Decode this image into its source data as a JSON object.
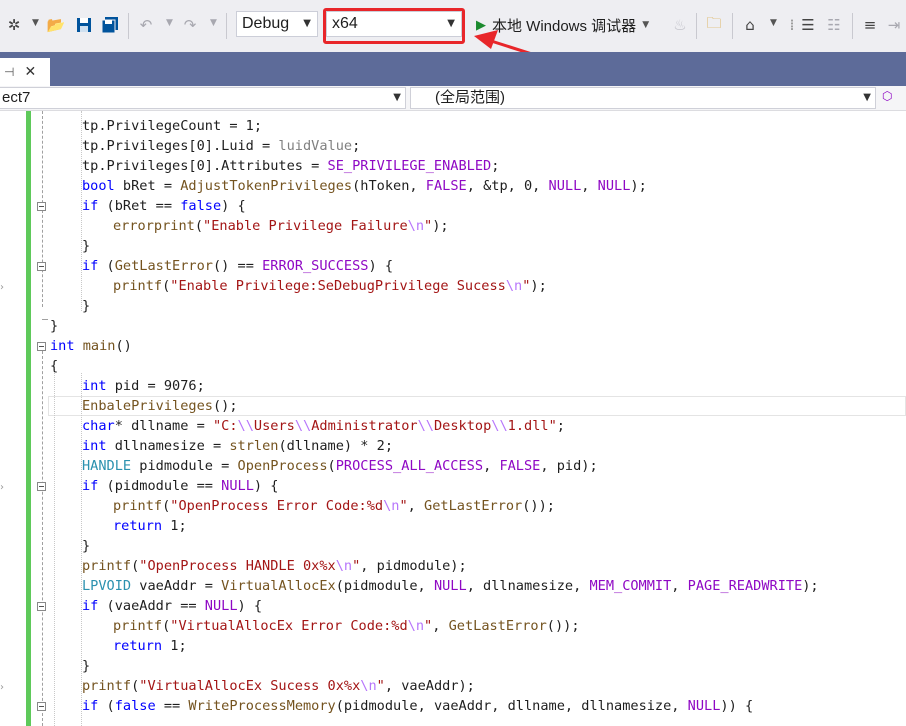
{
  "toolbar": {
    "config": "Debug",
    "platform": "x64",
    "run_label": "本地 Windows 调试器"
  },
  "tab": {
    "pin_glyph": "⊣",
    "close_glyph": "✕"
  },
  "navbar": {
    "project": "ect7",
    "scope": "(全局范围)"
  },
  "colors": {
    "keyword": "#0000ff",
    "type": "#2b91af",
    "function": "#74531f",
    "macro": "#8f08c4",
    "string": "#a31515",
    "escape": "#b776fb",
    "change_bar": "#5ec95a",
    "highlight": "#e8262a"
  },
  "code": {
    "lines": [
      {
        "indent": 1,
        "tokens": [
          [
            "tp.PrivilegeCount = 1;",
            ""
          ]
        ]
      },
      {
        "indent": 1,
        "tokens": [
          [
            "tp.Privileges[0].Luid = ",
            ""
          ],
          [
            "luidValue",
            "par"
          ],
          [
            ";",
            ""
          ]
        ]
      },
      {
        "indent": 1,
        "tokens": [
          [
            "tp.Privileges[0].Attributes = ",
            ""
          ],
          [
            "SE_PRIVILEGE_ENABLED",
            "mac"
          ],
          [
            ";",
            ""
          ]
        ]
      },
      {
        "indent": 1,
        "tokens": [
          [
            "bool",
            "kw"
          ],
          [
            " bRet = ",
            ""
          ],
          [
            "AdjustTokenPrivileges",
            "fn"
          ],
          [
            "(hToken, ",
            ""
          ],
          [
            "FALSE",
            "mac"
          ],
          [
            ", &tp, 0, ",
            ""
          ],
          [
            "NULL",
            "mac"
          ],
          [
            ", ",
            ""
          ],
          [
            "NULL",
            "mac"
          ],
          [
            ");",
            ""
          ]
        ]
      },
      {
        "indent": 1,
        "tokens": [
          [
            "if",
            "kw"
          ],
          [
            " (bRet == ",
            ""
          ],
          [
            "false",
            "kw"
          ],
          [
            ") {",
            ""
          ]
        ]
      },
      {
        "indent": 2,
        "tokens": [
          [
            "errorprint",
            "fn"
          ],
          [
            "(",
            ""
          ],
          [
            "\"Enable Privilege Failure",
            "str"
          ],
          [
            "\\n",
            "esc"
          ],
          [
            "\"",
            "str"
          ],
          [
            ");",
            ""
          ]
        ]
      },
      {
        "indent": 1,
        "tokens": [
          [
            "}",
            ""
          ]
        ]
      },
      {
        "indent": 1,
        "tokens": [
          [
            "if",
            "kw"
          ],
          [
            " (",
            ""
          ],
          [
            "GetLastError",
            "fn"
          ],
          [
            "() == ",
            ""
          ],
          [
            "ERROR_SUCCESS",
            "mac"
          ],
          [
            ") {",
            ""
          ]
        ]
      },
      {
        "indent": 2,
        "tokens": [
          [
            "printf",
            "fn"
          ],
          [
            "(",
            ""
          ],
          [
            "\"Enable Privilege:SeDebugPrivilege Sucess",
            "str"
          ],
          [
            "\\n",
            "esc"
          ],
          [
            "\"",
            "str"
          ],
          [
            ");",
            ""
          ]
        ]
      },
      {
        "indent": 1,
        "tokens": [
          [
            "}",
            ""
          ]
        ]
      },
      {
        "indent": 0,
        "tokens": [
          [
            "}",
            ""
          ]
        ]
      },
      {
        "indent": 0,
        "tokens": [
          [
            "int",
            "kw"
          ],
          [
            " ",
            ""
          ],
          [
            "main",
            "fn"
          ],
          [
            "()",
            ""
          ]
        ]
      },
      {
        "indent": 0,
        "tokens": [
          [
            "{",
            ""
          ]
        ]
      },
      {
        "indent": 1,
        "tokens": [
          [
            "int",
            "kw"
          ],
          [
            " pid = 9076;",
            ""
          ]
        ]
      },
      {
        "indent": 1,
        "tokens": [
          [
            "EnbalePrivileges",
            "fn"
          ],
          [
            "();",
            ""
          ]
        ]
      },
      {
        "indent": 1,
        "tokens": [
          [
            "char",
            "kw"
          ],
          [
            "* dllname = ",
            ""
          ],
          [
            "\"C:",
            "str"
          ],
          [
            "\\\\",
            "esc"
          ],
          [
            "Users",
            "str"
          ],
          [
            "\\\\",
            "esc"
          ],
          [
            "Administrator",
            "str"
          ],
          [
            "\\\\",
            "esc"
          ],
          [
            "Desktop",
            "str"
          ],
          [
            "\\\\",
            "esc"
          ],
          [
            "1.dll\"",
            "str"
          ],
          [
            ";",
            ""
          ]
        ]
      },
      {
        "indent": 1,
        "tokens": [
          [
            "int",
            "kw"
          ],
          [
            " dllnamesize = ",
            ""
          ],
          [
            "strlen",
            "fn"
          ],
          [
            "(dllname) * 2;",
            ""
          ]
        ]
      },
      {
        "indent": 1,
        "tokens": [
          [
            "HANDLE",
            "ty"
          ],
          [
            " pidmodule = ",
            ""
          ],
          [
            "OpenProcess",
            "fn"
          ],
          [
            "(",
            ""
          ],
          [
            "PROCESS_ALL_ACCESS",
            "mac"
          ],
          [
            ", ",
            ""
          ],
          [
            "FALSE",
            "mac"
          ],
          [
            ", pid);",
            ""
          ]
        ]
      },
      {
        "indent": 1,
        "tokens": [
          [
            "if",
            "kw"
          ],
          [
            " (pidmodule == ",
            ""
          ],
          [
            "NULL",
            "mac"
          ],
          [
            ") {",
            ""
          ]
        ]
      },
      {
        "indent": 2,
        "tokens": [
          [
            "printf",
            "fn"
          ],
          [
            "(",
            ""
          ],
          [
            "\"OpenProcess Error Code:%d",
            "str"
          ],
          [
            "\\n",
            "esc"
          ],
          [
            "\"",
            "str"
          ],
          [
            ", ",
            ""
          ],
          [
            "GetLastError",
            "fn"
          ],
          [
            "());",
            ""
          ]
        ]
      },
      {
        "indent": 2,
        "tokens": [
          [
            "return",
            "kw"
          ],
          [
            " 1;",
            ""
          ]
        ]
      },
      {
        "indent": 1,
        "tokens": [
          [
            "}",
            ""
          ]
        ]
      },
      {
        "indent": 1,
        "tokens": [
          [
            "printf",
            "fn"
          ],
          [
            "(",
            ""
          ],
          [
            "\"OpenProcess HANDLE 0x%x",
            "str"
          ],
          [
            "\\n",
            "esc"
          ],
          [
            "\"",
            "str"
          ],
          [
            ", pidmodule);",
            ""
          ]
        ]
      },
      {
        "indent": 1,
        "tokens": [
          [
            "LPVOID",
            "ty"
          ],
          [
            " vaeAddr = ",
            ""
          ],
          [
            "VirtualAllocEx",
            "fn"
          ],
          [
            "(pidmodule, ",
            ""
          ],
          [
            "NULL",
            "mac"
          ],
          [
            ", dllnamesize, ",
            ""
          ],
          [
            "MEM_COMMIT",
            "mac"
          ],
          [
            ", ",
            ""
          ],
          [
            "PAGE_READWRITE",
            "mac"
          ],
          [
            ");",
            ""
          ]
        ]
      },
      {
        "indent": 1,
        "tokens": [
          [
            "if",
            "kw"
          ],
          [
            " (vaeAddr == ",
            ""
          ],
          [
            "NULL",
            "mac"
          ],
          [
            ") {",
            ""
          ]
        ]
      },
      {
        "indent": 2,
        "tokens": [
          [
            "printf",
            "fn"
          ],
          [
            "(",
            ""
          ],
          [
            "\"VirtualAllocEx Error Code:%d",
            "str"
          ],
          [
            "\\n",
            "esc"
          ],
          [
            "\"",
            "str"
          ],
          [
            ", ",
            ""
          ],
          [
            "GetLastError",
            "fn"
          ],
          [
            "());",
            ""
          ]
        ]
      },
      {
        "indent": 2,
        "tokens": [
          [
            "return",
            "kw"
          ],
          [
            " 1;",
            ""
          ]
        ]
      },
      {
        "indent": 1,
        "tokens": [
          [
            "}",
            ""
          ]
        ]
      },
      {
        "indent": 1,
        "tokens": [
          [
            "printf",
            "fn"
          ],
          [
            "(",
            ""
          ],
          [
            "\"VirtualAllocEx Sucess 0x%x",
            "str"
          ],
          [
            "\\n",
            "esc"
          ],
          [
            "\"",
            "str"
          ],
          [
            ", vaeAddr);",
            ""
          ]
        ]
      },
      {
        "indent": 1,
        "tokens": [
          [
            "if",
            "kw"
          ],
          [
            " (",
            ""
          ],
          [
            "false",
            "kw"
          ],
          [
            " == ",
            ""
          ],
          [
            "WriteProcessMemory",
            "fn"
          ],
          [
            "(pidmodule, vaeAddr, dllname, dllnamesize, ",
            ""
          ],
          [
            "NULL",
            "mac"
          ],
          [
            ")) {",
            ""
          ]
        ]
      }
    ]
  }
}
